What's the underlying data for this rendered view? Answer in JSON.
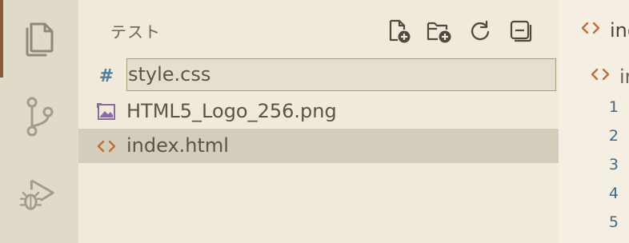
{
  "colors": {
    "activity_bar_bg": "#e0dac8",
    "active_indicator": "#8a5a33",
    "sidebar_bg": "#f0eadb",
    "selected_row_bg": "#d3cdbb",
    "css_icon": "#4f7fa0",
    "html_icon": "#c26a35",
    "image_icon": "#8a6aa0",
    "line_number": "#3f6b89"
  },
  "activity_bar": {
    "items": [
      {
        "icon": "files-icon",
        "active": true
      },
      {
        "icon": "source-control-icon",
        "active": false
      },
      {
        "icon": "run-debug-icon",
        "active": false
      }
    ]
  },
  "sidebar": {
    "title": "テスト",
    "toolbar": [
      {
        "icon": "new-file-icon"
      },
      {
        "icon": "new-folder-icon"
      },
      {
        "icon": "refresh-icon"
      },
      {
        "icon": "collapse-all-icon"
      }
    ],
    "rename_input": {
      "value": "style.css",
      "icon_glyph": "#"
    },
    "files": [
      {
        "name": "HTML5_Logo_256.png",
        "icon": "image-file-icon"
      },
      {
        "name": "index.html",
        "icon": "html-file-icon",
        "selected": true
      }
    ]
  },
  "editor": {
    "tab_label": "inc",
    "breadcrumb_label": "ir",
    "line_numbers": [
      "1",
      "2",
      "3",
      "4",
      "5"
    ]
  }
}
